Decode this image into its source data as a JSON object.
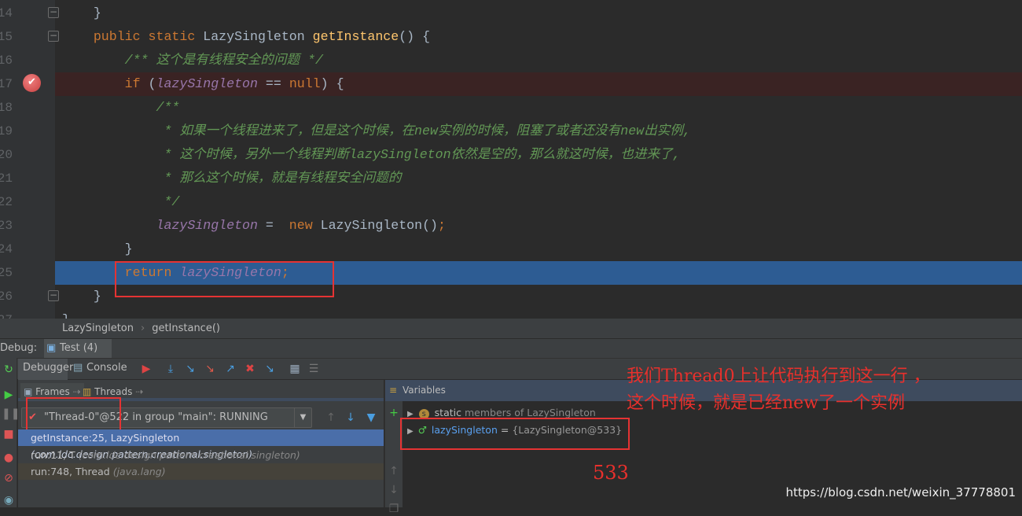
{
  "editor": {
    "lines": [
      {
        "num": "14",
        "tokens": [
          {
            "t": "    ",
            "c": "i"
          },
          {
            "t": "}",
            "c": "i"
          }
        ]
      },
      {
        "num": "15",
        "tokens": [
          {
            "t": "    public static ",
            "c": "k"
          },
          {
            "t": "LazySingleton ",
            "c": "i"
          },
          {
            "t": "getInstance",
            "c": "m"
          },
          {
            "t": "() {",
            "c": "i"
          }
        ]
      },
      {
        "num": "16",
        "tokens": [
          {
            "t": "        /** 这个是有线程安全的问题 */",
            "c": "c"
          }
        ]
      },
      {
        "num": "17",
        "tokens": [
          {
            "t": "        if ",
            "c": "k"
          },
          {
            "t": "(",
            "c": "i"
          },
          {
            "t": "lazySingleton",
            "c": "f"
          },
          {
            "t": " == ",
            "c": "i"
          },
          {
            "t": "null",
            "c": "k"
          },
          {
            "t": ") {",
            "c": "i"
          }
        ]
      },
      {
        "num": "18",
        "tokens": [
          {
            "t": "            /**",
            "c": "c"
          }
        ]
      },
      {
        "num": "19",
        "tokens": [
          {
            "t": "             * 如果一个线程进来了，但是这个时候，在new实例的时候，阻塞了或者还没有new出实例,",
            "c": "c"
          }
        ]
      },
      {
        "num": "20",
        "tokens": [
          {
            "t": "             * 这个时候，另外一个线程判断lazySingleton依然是空的，那么就这时候，也进来了,",
            "c": "c"
          }
        ]
      },
      {
        "num": "21",
        "tokens": [
          {
            "t": "             * 那么这个时候，就是有线程安全问题的",
            "c": "c"
          }
        ]
      },
      {
        "num": "22",
        "tokens": [
          {
            "t": "             */",
            "c": "c"
          }
        ]
      },
      {
        "num": "23",
        "tokens": [
          {
            "t": "            ",
            "c": "i"
          },
          {
            "t": "lazySingleton",
            "c": "f"
          },
          {
            "t": " =  ",
            "c": "i"
          },
          {
            "t": "new ",
            "c": "k"
          },
          {
            "t": "LazySingleton()",
            "c": "i"
          },
          {
            "t": ";",
            "c": "k"
          }
        ]
      },
      {
        "num": "24",
        "tokens": [
          {
            "t": "        }",
            "c": "i"
          }
        ]
      },
      {
        "num": "25",
        "tokens": [
          {
            "t": "        return ",
            "c": "k"
          },
          {
            "t": "lazySingleton",
            "c": "f"
          },
          {
            "t": ";",
            "c": "k"
          }
        ]
      },
      {
        "num": "26",
        "tokens": [
          {
            "t": "    }",
            "c": "i"
          }
        ]
      },
      {
        "num": "27",
        "tokens": [
          {
            "t": "}",
            "c": "i"
          }
        ]
      }
    ],
    "breakpoint_line": "17",
    "current_line": "25"
  },
  "breadcrumb": {
    "class": "LazySingleton",
    "method": "getInstance()"
  },
  "debug": {
    "label": "Debug:",
    "tab": "Test (4)",
    "close": "×"
  },
  "toolbar": {
    "debugger": "Debugger",
    "console": "Console"
  },
  "frames": {
    "tab_frames": "Frames",
    "tab_threads": "Threads",
    "thread": "\"Thread-0\"@522 in group \"main\": RUNNING",
    "rows": [
      {
        "method": "getInstance:25, LazySingleton",
        "pkg": "(com.ldc.design.pattern.creational.singleton)"
      },
      {
        "method": "run:11, T",
        "pkg": "(com.ldc.design.pattern.creational.singleton)"
      },
      {
        "method": "run:748, Thread",
        "pkg": "(java.lang)"
      }
    ]
  },
  "variables": {
    "title": "Variables",
    "static_kw": "static",
    "static_rest": " members of LazySingleton",
    "var_name": "lazySingleton",
    "var_eq": " = ",
    "var_value": "{LazySingleton@533}"
  },
  "annotations": {
    "line1": "我们Thread0上让代码执行到这一行 ，",
    "line2": "这个时候，就是已经new了一个实例",
    "value": "533"
  },
  "watermark": "https://blog.csdn.net/weixin_37778801",
  "colors": {
    "keyword": "#cc7832",
    "field": "#9876aa",
    "comment": "#629755",
    "method": "#ffc66d",
    "current_line": "#2d5c93",
    "annotation": "#e8302c"
  }
}
